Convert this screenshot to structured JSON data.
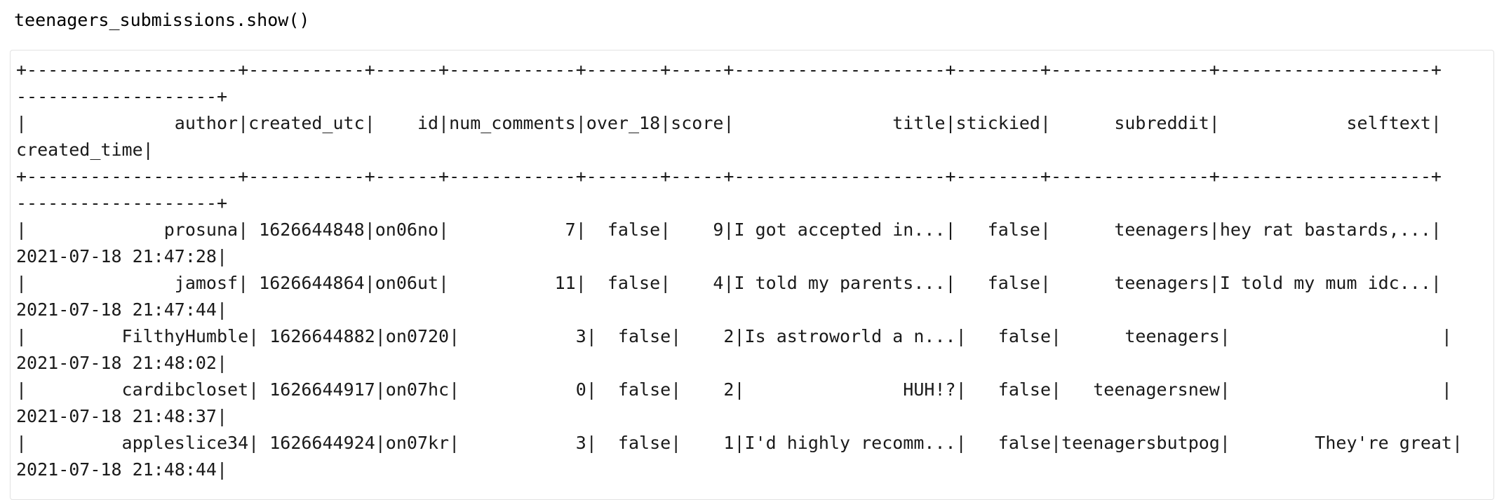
{
  "cell": {
    "code": "teenagers_submissions.show()"
  },
  "output": {
    "lines": [
      "+--------------------+-----------+------+------------+-------+-----+--------------------+--------+---------------+--------------------+",
      "-------------------+",
      "|              author|created_utc|    id|num_comments|over_18|score|               title|stickied|      subreddit|            selftext|",
      "created_time|",
      "+--------------------+-----------+------+------------+-------+-----+--------------------+--------+---------------+--------------------+",
      "-------------------+",
      "|             prosuna| 1626644848|on06no|           7|  false|    9|I got accepted in...|   false|      teenagers|hey rat bastards,...|",
      "2021-07-18 21:47:28|",
      "|              jamosf| 1626644864|on06ut|          11|  false|    4|I told my parents...|   false|      teenagers|I told my mum idc...|",
      "2021-07-18 21:47:44|",
      "|         FilthyHumble| 1626644882|on0720|           3|  false|    2|Is astroworld a n...|   false|      teenagers|                    |",
      "2021-07-18 21:48:02|",
      "|         cardibcloset| 1626644917|on07hc|           0|  false|    2|               HUH!?|   false|   teenagersnew|                    |",
      "2021-07-18 21:48:37|",
      "|         appleslice34| 1626644924|on07kr|           3|  false|    1|I'd highly recomm...|   false|teenagersbutpog|        They're great|",
      "2021-07-18 21:48:44|"
    ]
  }
}
